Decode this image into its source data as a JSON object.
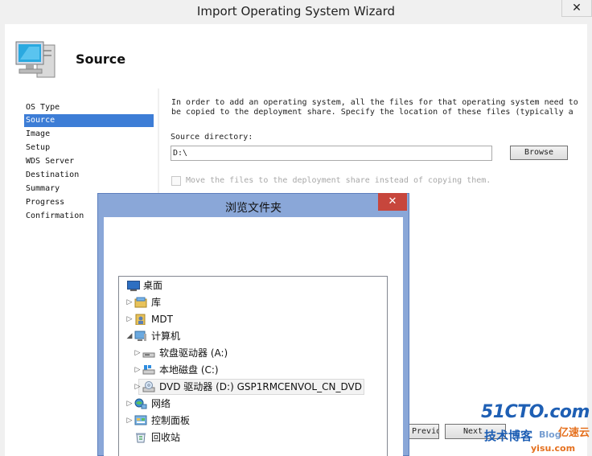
{
  "wizard": {
    "title": "Import Operating System Wizard",
    "close_glyph": "✕",
    "header_title": "Source",
    "nav_items": [
      "OS Type",
      "Source",
      "Image",
      "Setup",
      "WDS Server",
      "Destination",
      "Summary",
      "Progress",
      "Confirmation"
    ],
    "selected_nav": "Source",
    "description_line1": "In order to add an operating system, all the files for that operating system need to",
    "description_line2": "be copied to the deployment share.  Specify the location of these files (typically a",
    "source_label": "Source directory:",
    "source_value": "D:\\",
    "browse_label": "Browse",
    "move_checkbox_label": "Move the files to the deployment share instead of copying them.",
    "previous_label": "Previous",
    "next_label": "Next"
  },
  "dialog": {
    "title": "浏览文件夹",
    "close_glyph": "✕",
    "tree": [
      {
        "label": "桌面",
        "icon": "desktop-icon"
      },
      {
        "label": "库",
        "icon": "library-icon"
      },
      {
        "label": "MDT",
        "icon": "user-folder-icon"
      },
      {
        "label": "计算机",
        "icon": "computer-icon"
      },
      {
        "label": "软盘驱动器 (A:)",
        "icon": "floppy-drive-icon"
      },
      {
        "label": "本地磁盘 (C:)",
        "icon": "local-disk-icon"
      },
      {
        "label": "DVD 驱动器 (D:) GSP1RMCENVOL_CN_DVD",
        "icon": "dvd-drive-icon"
      },
      {
        "label": "网络",
        "icon": "network-icon"
      },
      {
        "label": "控制面板",
        "icon": "control-panel-icon"
      },
      {
        "label": "回收站",
        "icon": "recycle-bin-icon"
      }
    ]
  },
  "watermark": {
    "line1": "51CTO.com",
    "line2": "技术博客",
    "line3": "Blog",
    "line4": "亿速云",
    "line5": "yisu.com",
    "colors": {
      "blue": "#1e5fb4",
      "orange": "#e5701e"
    }
  }
}
